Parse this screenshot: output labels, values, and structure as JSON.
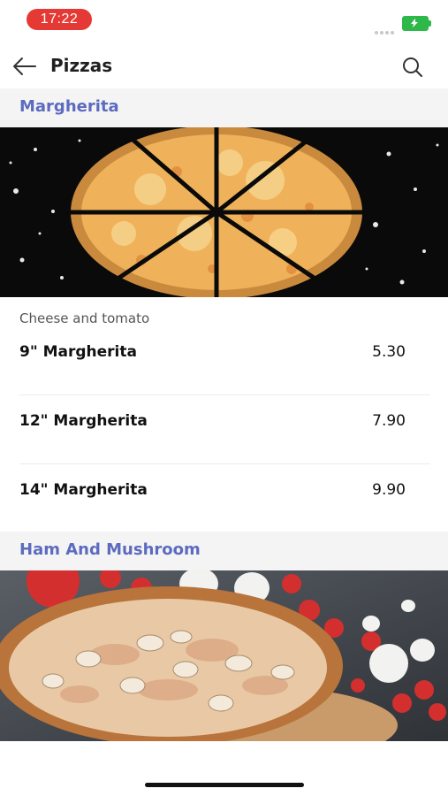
{
  "status_bar": {
    "time": "17:22",
    "battery_icon": "battery-charging-icon",
    "battery_color": "#2fb84a",
    "time_pill_color": "#e53935"
  },
  "nav": {
    "title": "Pizzas",
    "back_icon": "arrow-left-icon",
    "search_icon": "search-icon"
  },
  "accent_color": "#5c6bc0",
  "sections": [
    {
      "title": "Margherita",
      "description": "Cheese and tomato",
      "items": [
        {
          "name": "9\" Margherita",
          "price": "5.30"
        },
        {
          "name": "12\" Margherita",
          "price": "7.90"
        },
        {
          "name": "14\" Margherita",
          "price": "9.90"
        }
      ]
    },
    {
      "title": "Ham And Mushroom"
    }
  ]
}
